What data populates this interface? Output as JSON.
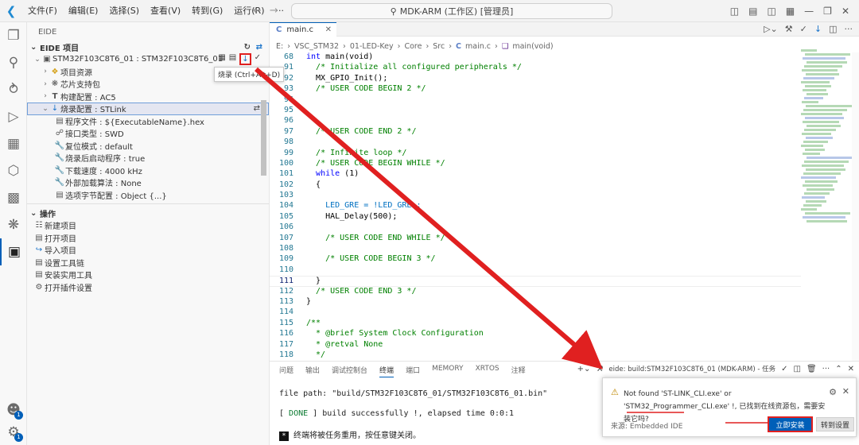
{
  "titlebar": {
    "menu": [
      "文件(F)",
      "编辑(E)",
      "选择(S)",
      "查看(V)",
      "转到(G)",
      "运行(R)",
      "···"
    ],
    "search_text": "MDK-ARM (工作区) [管理员]"
  },
  "sidebar": {
    "title": "EIDE",
    "project_section": "EIDE 项目",
    "project_name": "STM32F103C8T6_01 : STM32F103C8T6_01",
    "tooltip": "烧录 (Ctrl+Alt+D)",
    "tree": [
      {
        "label": "项目资源",
        "icon": "folder-icon"
      },
      {
        "label": "芯片支持包",
        "icon": "chip-icon"
      },
      {
        "label": "构建配置 : AC5",
        "icon": "build-icon"
      },
      {
        "label": "烧录配置 : STLink",
        "icon": "download-icon"
      }
    ],
    "flash_items": [
      {
        "label": "程序文件 : ${ExecutableName}.hex",
        "icon": "file-icon"
      },
      {
        "label": "接口类型 : SWD",
        "icon": "plug-icon"
      },
      {
        "label": "复位模式 : default",
        "icon": "wrench-icon"
      },
      {
        "label": "烧录后启动程序 : true",
        "icon": "wrench-icon"
      },
      {
        "label": "下载速度 : 4000 kHz",
        "icon": "wrench-icon"
      },
      {
        "label": "外部加载算法 : None",
        "icon": "wrench-icon"
      },
      {
        "label": "选项字节配置 : Object {...}",
        "icon": "file-icon"
      }
    ],
    "ops_section": "操作",
    "ops": [
      {
        "label": "新建项目",
        "icon": "new-project-icon"
      },
      {
        "label": "打开项目",
        "icon": "open-folder-icon"
      },
      {
        "label": "导入项目",
        "icon": "import-icon"
      },
      {
        "label": "设置工具链",
        "icon": "toolchain-icon"
      },
      {
        "label": "安装实用工具",
        "icon": "tools-icon"
      },
      {
        "label": "打开插件设置",
        "icon": "gear-icon"
      }
    ]
  },
  "editor": {
    "tab": "main.c",
    "breadcrumb": [
      "E:",
      "VSC_STM32",
      "01-LED-Key",
      "Core",
      "Src",
      "main.c",
      "main(void)"
    ],
    "lines": [
      {
        "n": "68",
        "t": "int main(void)"
      },
      {
        "n": "91",
        "t": "  /* Initialize all configured peripherals */"
      },
      {
        "n": "92",
        "t": "  MX_GPIO_Init();"
      },
      {
        "n": "93",
        "t": "  /* USER CODE BEGIN 2 */"
      },
      {
        "n": "94",
        "t": ""
      },
      {
        "n": "95",
        "t": ""
      },
      {
        "n": "96",
        "t": ""
      },
      {
        "n": "97",
        "t": "  /* USER CODE END 2 */"
      },
      {
        "n": "98",
        "t": ""
      },
      {
        "n": "99",
        "t": "  /* Infinite loop */"
      },
      {
        "n": "100",
        "t": "  /* USER CODE BEGIN WHILE */"
      },
      {
        "n": "101",
        "t": "  while (1)"
      },
      {
        "n": "102",
        "t": "  {"
      },
      {
        "n": "103",
        "t": ""
      },
      {
        "n": "104",
        "t": "    LED_GRE = !LED_GRE ;"
      },
      {
        "n": "105",
        "t": "    HAL_Delay(500);"
      },
      {
        "n": "106",
        "t": ""
      },
      {
        "n": "107",
        "t": "    /* USER CODE END WHILE */"
      },
      {
        "n": "108",
        "t": ""
      },
      {
        "n": "109",
        "t": "    /* USER CODE BEGIN 3 */"
      },
      {
        "n": "110",
        "t": ""
      },
      {
        "n": "111",
        "t": "  }"
      },
      {
        "n": "112",
        "t": "  /* USER CODE END 3 */"
      },
      {
        "n": "113",
        "t": "}"
      },
      {
        "n": "114",
        "t": ""
      },
      {
        "n": "115",
        "t": "/**"
      },
      {
        "n": "116",
        "t": "  * @brief System Clock Configuration"
      },
      {
        "n": "117",
        "t": "  * @retval None"
      },
      {
        "n": "118",
        "t": "  */"
      }
    ]
  },
  "panel": {
    "tabs": [
      "问题",
      "输出",
      "调试控制台",
      "终端",
      "端口",
      "MEMORY",
      "XRTOS",
      "注释"
    ],
    "active_tab": "终端",
    "task_label": "eide: build:STM32F103C8T6_01 (MDK-ARM) - 任务",
    "terminal": {
      "line1": "file path: \"build/STM32F103C8T6_01/STM32F103C8T6_01.bin\"",
      "done": "DONE",
      "line2": " build successfully !, elapsed time 0:0:1",
      "line3": "终端将被任务重用，按任意键关闭。"
    }
  },
  "notification": {
    "message": "Not found 'ST-LINK_CLI.exe' or 'STM32_Programmer_CLI.exe' !, 已找到在线资源包，需要安装它吗?",
    "source": "来源: Embedded IDE",
    "install_button": "立即安装",
    "settings_button": "转到设置"
  },
  "colors": {
    "accent": "#005fb8",
    "annotation": "#e02020",
    "comment": "#008000",
    "keyword": "#0000ff"
  }
}
